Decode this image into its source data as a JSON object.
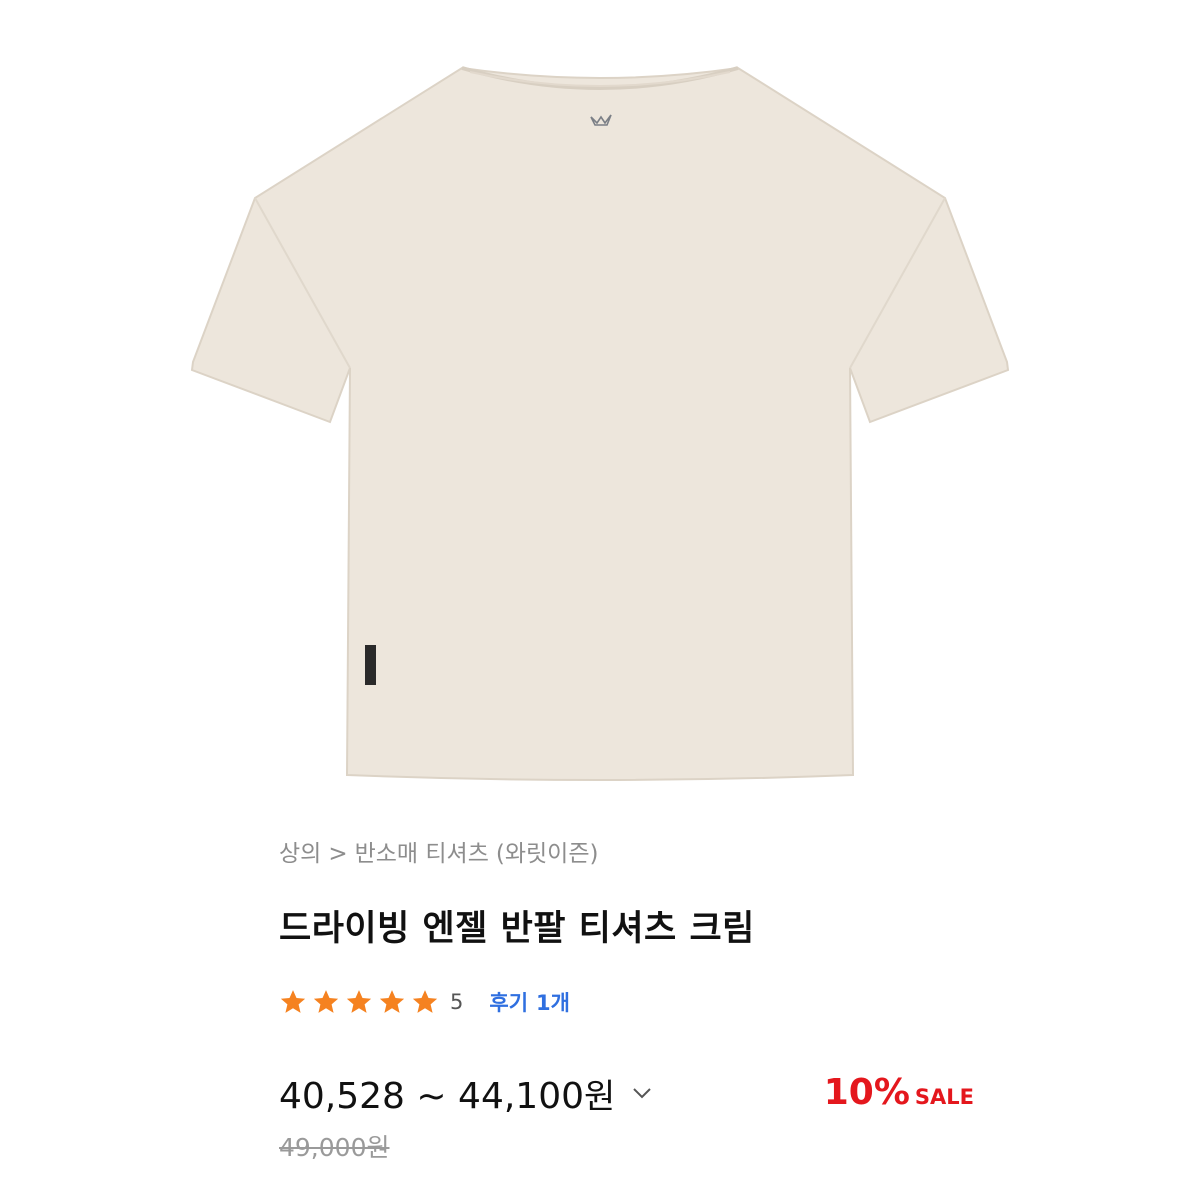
{
  "product": {
    "image_alt": "cream short sleeve t-shirt back view",
    "breadcrumb": {
      "category": "상의",
      "separator": ">",
      "subcategory": "반소매 티셔츠",
      "brand": "(와릿이즌)"
    },
    "title": "드라이빙 엔젤 반팔 티셔츠 크림",
    "rating": {
      "stars": 5,
      "score": "5",
      "review_label": "후기",
      "review_count": "1개"
    },
    "price": {
      "range_min": "40,528",
      "range_sep": "~",
      "range_max": "44,100",
      "currency": "원",
      "original": "49,000원",
      "discount_rate": "10%",
      "sale_label": "SALE"
    }
  },
  "colors": {
    "shirt": "#ede6dc",
    "star": "#f58220",
    "accent_blue": "#2f6fe0",
    "sale_red": "#e4171d"
  },
  "icons": {
    "star": "star-icon",
    "price_toggle": "chevron-down-icon",
    "collar_logo": "angel-logo-icon"
  }
}
